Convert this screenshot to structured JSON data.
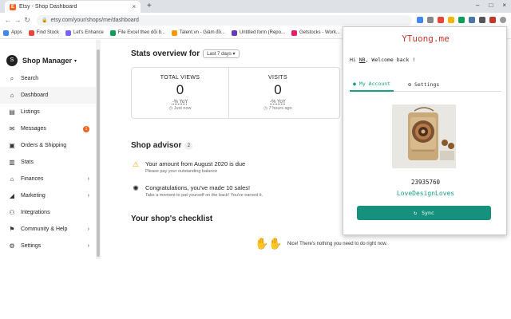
{
  "browser": {
    "tab_title": "Etsy - Shop Dashboard",
    "tab_close": "×",
    "new_tab": "+",
    "url": "etsy.com/your/shops/me/dashboard",
    "window_controls": [
      "–",
      "□",
      "×"
    ]
  },
  "bookmarks": [
    {
      "label": "Apps",
      "color": "#4285f4"
    },
    {
      "label": "Find Stock",
      "color": "#e8453c"
    },
    {
      "label": "Let's Enhance",
      "color": "#7b61ff"
    },
    {
      "label": "File Excel theo dõi b...",
      "color": "#0f9d58"
    },
    {
      "label": "Talent.vn - Giảm đồ...",
      "color": "#ff9800"
    },
    {
      "label": "Untitled form (Repo...",
      "color": "#673ab7"
    },
    {
      "label": "Getstocks - Work...",
      "color": "#e91e63"
    }
  ],
  "sidebar": {
    "title": "Shop Manager",
    "items": [
      {
        "label": "Search",
        "icon": "⌕"
      },
      {
        "label": "Dashboard",
        "icon": "⌂"
      },
      {
        "label": "Listings",
        "icon": "▤"
      },
      {
        "label": "Messages",
        "icon": "✉",
        "badge": "1"
      },
      {
        "label": "Orders & Shipping",
        "icon": "▣"
      },
      {
        "label": "Stats",
        "icon": "▥"
      },
      {
        "label": "Finances",
        "icon": "⌂",
        "arrow": "›"
      },
      {
        "label": "Marketing",
        "icon": "◢",
        "arrow": "›"
      },
      {
        "label": "Integrations",
        "icon": "⚇"
      },
      {
        "label": "Community & Help",
        "icon": "⚑",
        "arrow": "›"
      },
      {
        "label": "Settings",
        "icon": "⚙",
        "arrow": "›"
      }
    ]
  },
  "stats": {
    "title": "Stats overview for",
    "period": "Last 7 days",
    "cards": [
      {
        "label": "TOTAL VIEWS",
        "value": "0",
        "yoy": "-% YoY",
        "time": "Just now"
      },
      {
        "label": "VISITS",
        "value": "0",
        "yoy": "-% YoY",
        "time": "7 hours ago"
      }
    ]
  },
  "advisor": {
    "title": "Shop advisor",
    "count": "2",
    "items": [
      {
        "icon": "⚠",
        "main": "Your amount from August 2020 is due",
        "sub": "Please pay your outstanding balance"
      },
      {
        "icon": "✺",
        "main": "Congratulations, you've made 10 sales!",
        "sub": "Take a moment to pat yourself on the back! You've earned it."
      }
    ]
  },
  "checklist": {
    "title": "Your shop's checklist",
    "hands": "✋✋",
    "done_text": "Nice! There's nothing you need to do right now."
  },
  "extension": {
    "title": "YTuong.me",
    "greeting_prefix": "Hi ",
    "greeting_name": "NB",
    "greeting_suffix": ", Welcome back !",
    "tabs": [
      {
        "label": "My Account",
        "icon": "●"
      },
      {
        "label": "Settings",
        "icon": "⚙"
      }
    ],
    "product_id": "23935760",
    "shop_name": "LoveDesignLoves",
    "sync_label": "Sync",
    "sync_icon": "↻",
    "accent_color": "#16917e",
    "title_color": "#c0392b"
  }
}
